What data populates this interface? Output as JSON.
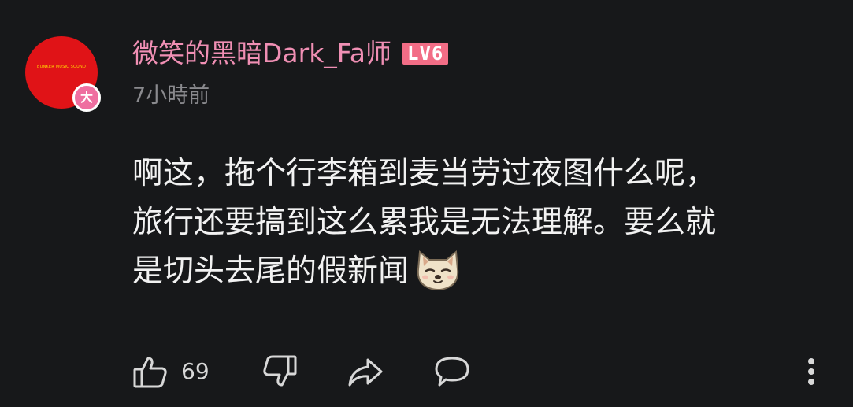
{
  "comment": {
    "avatar": {
      "image_text": "BUNKER MUSIC SOUND",
      "badge_text": "大"
    },
    "username": "微笑的黑暗Dark_Fa师",
    "level_badge": "LV6",
    "timestamp": "7小時前",
    "body_lines": [
      "啊这，拖个行李箱到麦当劳过夜图什么呢，",
      "旅行还要搞到这么累我是无法理解。要么就",
      "是切头去尾的假新闻"
    ],
    "emoji_icon": "shiba-dog-emoji-icon",
    "actions": {
      "like_icon": "thumbs-up-icon",
      "like_count": "69",
      "dislike_icon": "thumbs-down-icon",
      "share_icon": "share-arrow-icon",
      "reply_icon": "speech-bubble-icon",
      "more_icon": "vertical-ellipsis-icon"
    }
  },
  "colors": {
    "background": "#17181a",
    "username": "#f08fb4",
    "level_badge": "#f26d86",
    "avatar": "#e01317",
    "avatar_badge": "#ef6ea0",
    "body_text": "#f2f2f2",
    "muted_text": "#8a8a8e"
  }
}
